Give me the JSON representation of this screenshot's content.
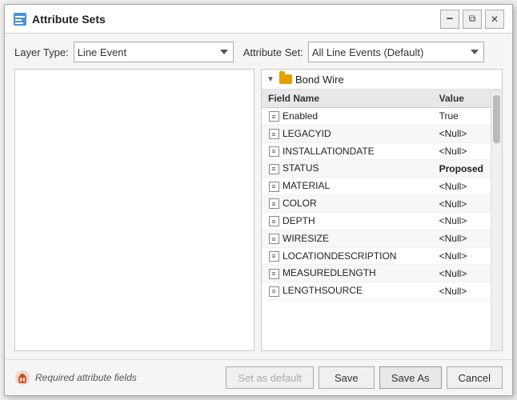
{
  "dialog": {
    "title": "Attribute Sets"
  },
  "header": {
    "layer_type_label": "Layer Type:",
    "layer_type_value": "Line Event",
    "attribute_set_label": "Attribute Set:",
    "attribute_set_value": "All Line Events (Default)"
  },
  "tree": {
    "node_label": "Bond Wire",
    "expand_char": "◄"
  },
  "table": {
    "col_field": "Field Name",
    "col_value": "Value",
    "rows": [
      {
        "field": "Enabled",
        "value": "True",
        "value_class": "value-true"
      },
      {
        "field": "LEGACYID",
        "value": "<Null>",
        "value_class": "value-null"
      },
      {
        "field": "INSTALLATIONDATE",
        "value": "<Null>",
        "value_class": "value-null"
      },
      {
        "field": "STATUS",
        "value": "Proposed",
        "value_class": "value-proposed"
      },
      {
        "field": "MATERIAL",
        "value": "<Null>",
        "value_class": "value-null"
      },
      {
        "field": "COLOR",
        "value": "<Null>",
        "value_class": "value-null"
      },
      {
        "field": "DEPTH",
        "value": "<Null>",
        "value_class": "value-null"
      },
      {
        "field": "WIRESIZE",
        "value": "<Null>",
        "value_class": "value-null"
      },
      {
        "field": "LOCATIONDESCRIPTION",
        "value": "<Null>",
        "value_class": "value-null"
      },
      {
        "field": "MEASUREDLENGTH",
        "value": "<Null>",
        "value_class": "value-null"
      },
      {
        "field": "LENGTHSOURCE",
        "value": "<Null>",
        "value_class": "value-null"
      }
    ]
  },
  "footer": {
    "required_text": "Required attribute fields",
    "btn_set_default": "Set as default",
    "btn_save": "Save",
    "btn_save_as": "Save As",
    "btn_cancel": "Cancel"
  },
  "icons": {
    "minimize": "🗕",
    "restore": "⧉",
    "close": "✕"
  }
}
